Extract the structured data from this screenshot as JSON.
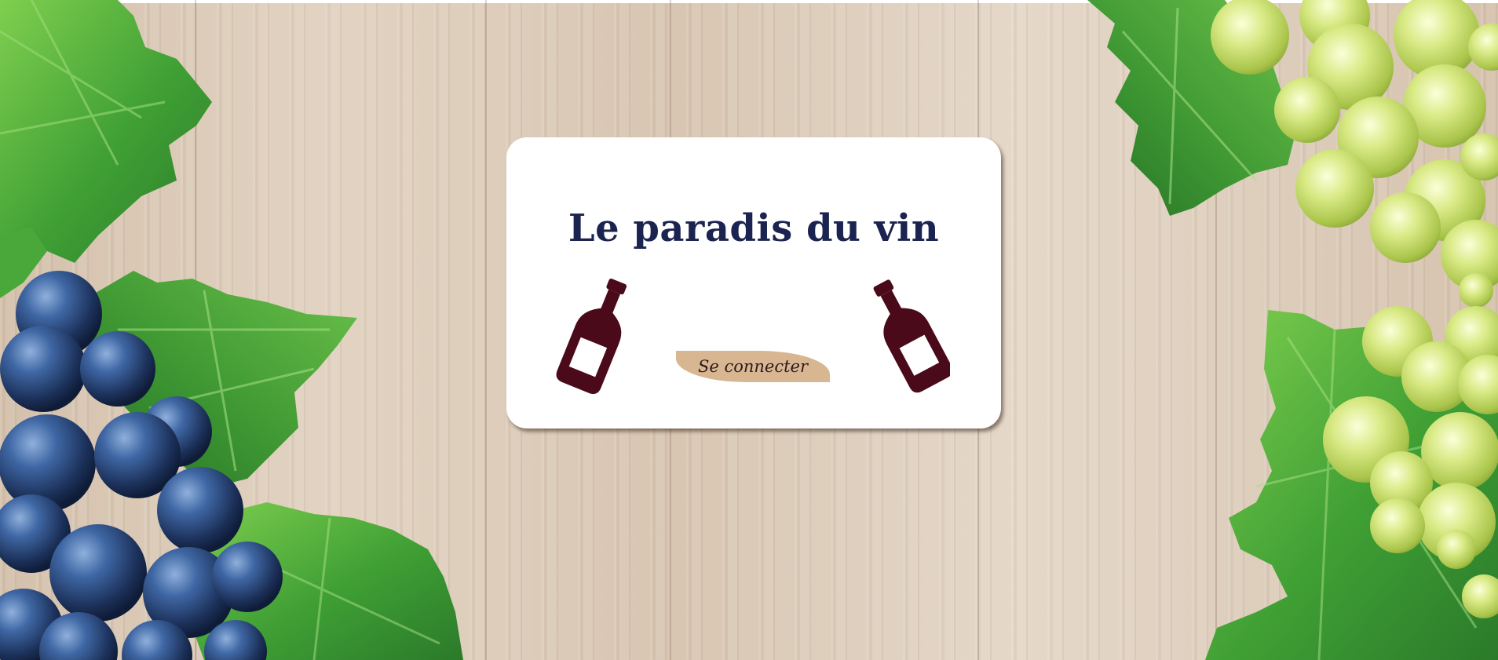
{
  "hero": {
    "title": "Le paradis du vin",
    "login_label": "Se connecter"
  },
  "icons": {
    "left_bottle": "wine-bottle-icon",
    "right_bottle": "wine-bottle-icon"
  },
  "colors": {
    "title": "#1b2350",
    "bottle": "#4a0a1a",
    "button": "#d9b692",
    "card": "#ffffff"
  }
}
